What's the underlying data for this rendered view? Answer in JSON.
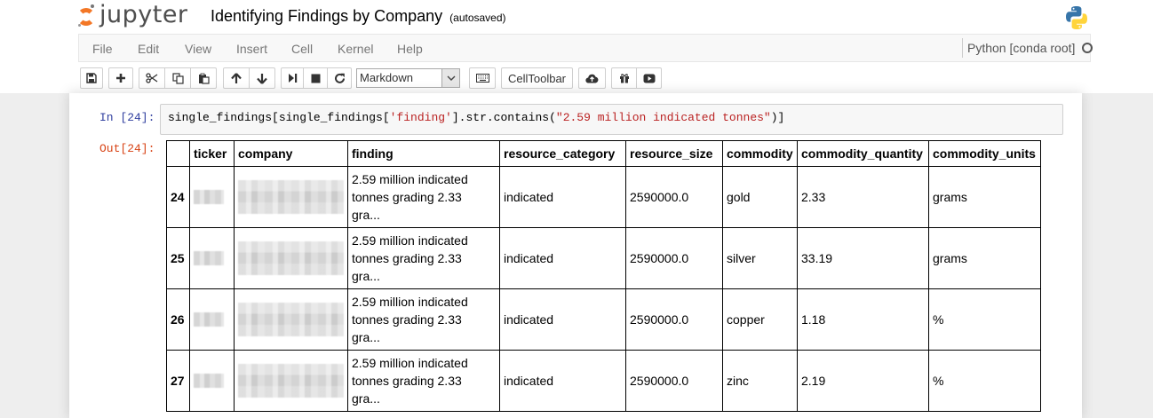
{
  "header": {
    "logo_text": "jupyter",
    "notebook_name": "Identifying Findings by Company",
    "save_status": "(autosaved)"
  },
  "menubar": {
    "items": [
      "File",
      "Edit",
      "View",
      "Insert",
      "Cell",
      "Kernel",
      "Help"
    ],
    "kernel_name": "Python [conda root]"
  },
  "toolbar": {
    "cell_type_selected": "Markdown",
    "celltoolbar_label": "CellToolbar"
  },
  "cell": {
    "in_prompt": "In [24]:",
    "out_prompt": "Out[24]:",
    "code": {
      "p1": "single_findings[single_findings[",
      "s1": "'finding'",
      "p2": "].",
      "a1": "str",
      "p3": ".contains(",
      "s2": "\"2.59 million indicated tonnes\"",
      "p4": ")]"
    }
  },
  "output_table": {
    "columns": [
      "ticker",
      "company",
      "finding",
      "resource_category",
      "resource_size",
      "commodity",
      "commodity_quantity",
      "commodity_units"
    ],
    "rows": [
      {
        "index": "24",
        "finding": [
          "2.59 million indicated",
          "tonnes grading 2.33",
          "gra..."
        ],
        "resource_category": "indicated",
        "resource_size": "2590000.0",
        "commodity": "gold",
        "commodity_quantity": "2.33",
        "commodity_units": "grams"
      },
      {
        "index": "25",
        "finding": [
          "2.59 million indicated",
          "tonnes grading 2.33",
          "gra..."
        ],
        "resource_category": "indicated",
        "resource_size": "2590000.0",
        "commodity": "silver",
        "commodity_quantity": "33.19",
        "commodity_units": "grams"
      },
      {
        "index": "26",
        "finding": [
          "2.59 million indicated",
          "tonnes grading 2.33",
          "gra..."
        ],
        "resource_category": "indicated",
        "resource_size": "2590000.0",
        "commodity": "copper",
        "commodity_quantity": "1.18",
        "commodity_units": "%"
      },
      {
        "index": "27",
        "finding": [
          "2.59 million indicated",
          "tonnes grading 2.33",
          "gra..."
        ],
        "resource_category": "indicated",
        "resource_size": "2590000.0",
        "commodity": "zinc",
        "commodity_quantity": "2.19",
        "commodity_units": "%"
      }
    ]
  },
  "icons": {
    "toolbar": [
      "save-icon",
      "plus-icon",
      "cut-icon",
      "copy-icon",
      "paste-icon",
      "arrow-up-icon",
      "arrow-down-icon",
      "step-forward-icon",
      "stop-icon",
      "refresh-icon",
      "keyboard-icon",
      "cloud-upload-icon",
      "gift-icon",
      "youtube-play-icon"
    ],
    "brand": [
      "jupyter-logo",
      "python-logo-icon"
    ]
  },
  "colors": {
    "in_prompt": "#303f9f",
    "out_prompt": "#d84315",
    "string_token": "#ba2121",
    "logo_orange": "#f37726"
  }
}
